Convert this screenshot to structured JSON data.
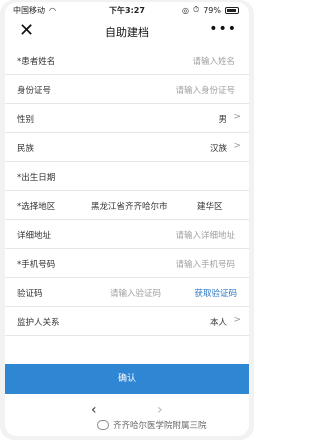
{
  "status_bar": {
    "carrier": "中国移动",
    "time": "下午3:27",
    "battery": "79%"
  },
  "header": {
    "close_icon": "close-icon",
    "title": "自助建档",
    "more_icon": "more-dots-icon",
    "more_glyph": "•••"
  },
  "form": {
    "name": {
      "label": "*患者姓名",
      "placeholder": "请输入姓名"
    },
    "id_number": {
      "label": "身份证号",
      "placeholder": "请输入身份证号"
    },
    "gender": {
      "label": "性别",
      "value": "男"
    },
    "ethnicity": {
      "label": "民族",
      "value": "汉族"
    },
    "birth_date": {
      "label": "*出生日期"
    },
    "region": {
      "label": "*选择地区",
      "province": "黑龙江省齐齐哈尔市",
      "district": "建华区"
    },
    "address": {
      "label": "详细地址",
      "placeholder": "请输入详细地址"
    },
    "phone": {
      "label": "*手机号码",
      "placeholder": "请输入手机号码"
    },
    "verify_code": {
      "label": "验证码",
      "placeholder": "请输入验证码",
      "get_code": "获取验证码"
    },
    "guardian": {
      "label": "监护人关系",
      "value": "本人"
    }
  },
  "confirm_label": "确认",
  "bottom_nav": {
    "back_glyph": "‹",
    "forward_glyph": "›",
    "watermark": "齐齐哈尔医学院附属三院"
  },
  "colors": {
    "accent": "#2f86d3",
    "link": "#2b77c5"
  }
}
